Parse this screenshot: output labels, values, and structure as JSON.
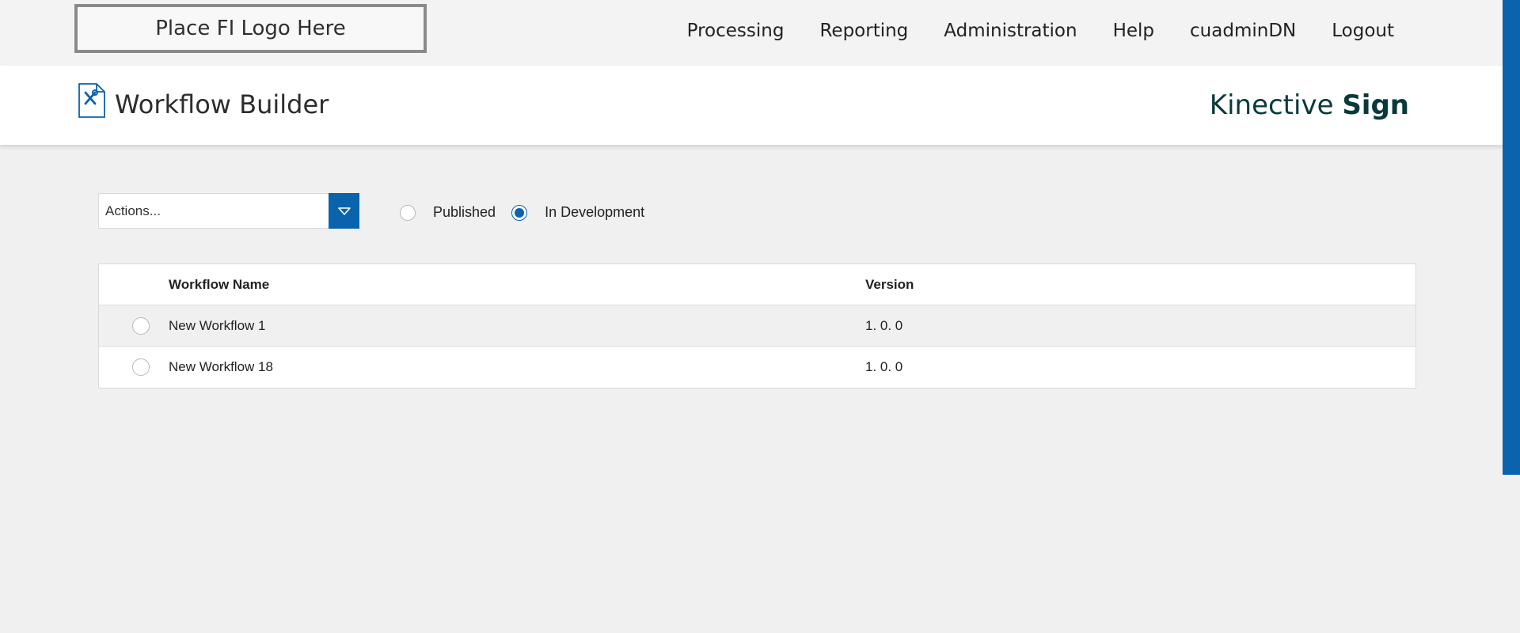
{
  "header": {
    "logo_placeholder": "Place FI Logo Here",
    "nav": [
      "Processing",
      "Reporting",
      "Administration",
      "Help",
      "cuadminDN",
      "Logout"
    ]
  },
  "page": {
    "title": "Workflow Builder",
    "brand_light": "Kinective",
    "brand_bold": "Sign"
  },
  "toolbar": {
    "actions_value": "Actions...",
    "filters": [
      {
        "label": "Published",
        "selected": false
      },
      {
        "label": "In Development",
        "selected": true
      }
    ]
  },
  "table": {
    "columns": [
      "Workflow Name",
      "Version"
    ],
    "rows": [
      {
        "name": "New Workflow 1",
        "version": "1. 0. 0"
      },
      {
        "name": "New Workflow 18",
        "version": "1. 0. 0"
      }
    ]
  },
  "colors": {
    "accent": "#0a63ad",
    "brand_text": "#083a3c"
  },
  "icons": [
    "document-tools-icon",
    "chevron-down-icon"
  ]
}
